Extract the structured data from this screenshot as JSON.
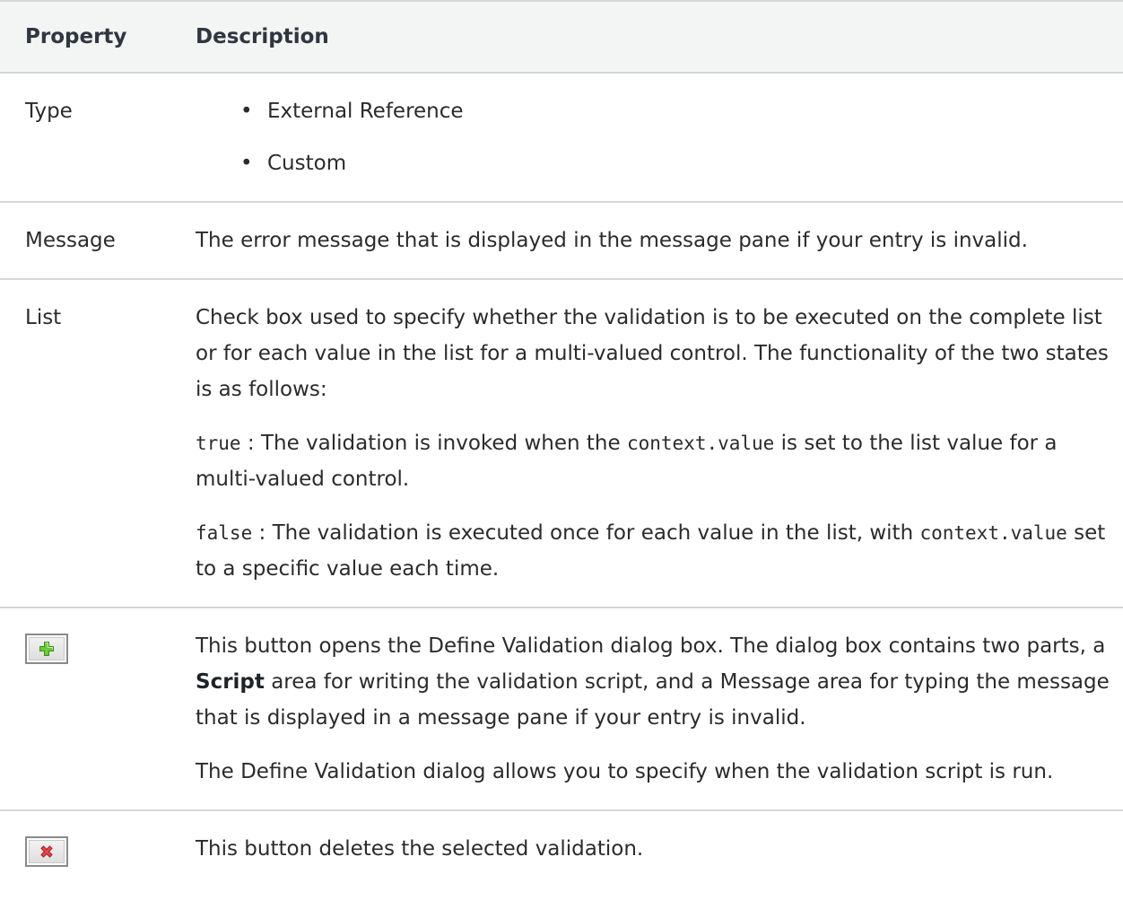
{
  "table": {
    "header": {
      "property": "Property",
      "description": "Description"
    },
    "rows": {
      "type": {
        "property": "Type",
        "items": [
          "External Reference",
          "Custom"
        ]
      },
      "message": {
        "property": "Message",
        "description": "The error message that is displayed in the message pane if your entry is invalid."
      },
      "list": {
        "property": "List",
        "p1": "Check box used to specify whether the validation is to be executed on the complete list or for each value in the list for a multi-valued control. The functionality of the two states is as follows:",
        "true_code": "true",
        "true_text_a": " : The validation is invoked when the ",
        "true_code2": "context.value",
        "true_text_b": " is set to the list value for a multi-valued control.",
        "false_code": "false",
        "false_text_a": " : The validation is executed once for each value in the list, with ",
        "false_code2": "context.value",
        "false_text_b": " set to a specific value each time."
      },
      "add": {
        "icon": "add-plus-icon",
        "p1_a": "This button opens the Define Validation dialog box. The dialog box contains two parts, a ",
        "p1_bold": "Script",
        "p1_b": " area for writing the validation script, and a Message area for typing the message that is displayed in a message pane if your entry is invalid.",
        "p2": "The Define Validation dialog allows you to specify when the validation script is run."
      },
      "delete": {
        "icon": "delete-x-icon",
        "description": "This button deletes the selected validation."
      }
    }
  },
  "colors": {
    "plus": "#5fbf2a",
    "cross": "#e0323a",
    "rule": "#d4d6d8",
    "header_bg": "#f3f4f4"
  }
}
